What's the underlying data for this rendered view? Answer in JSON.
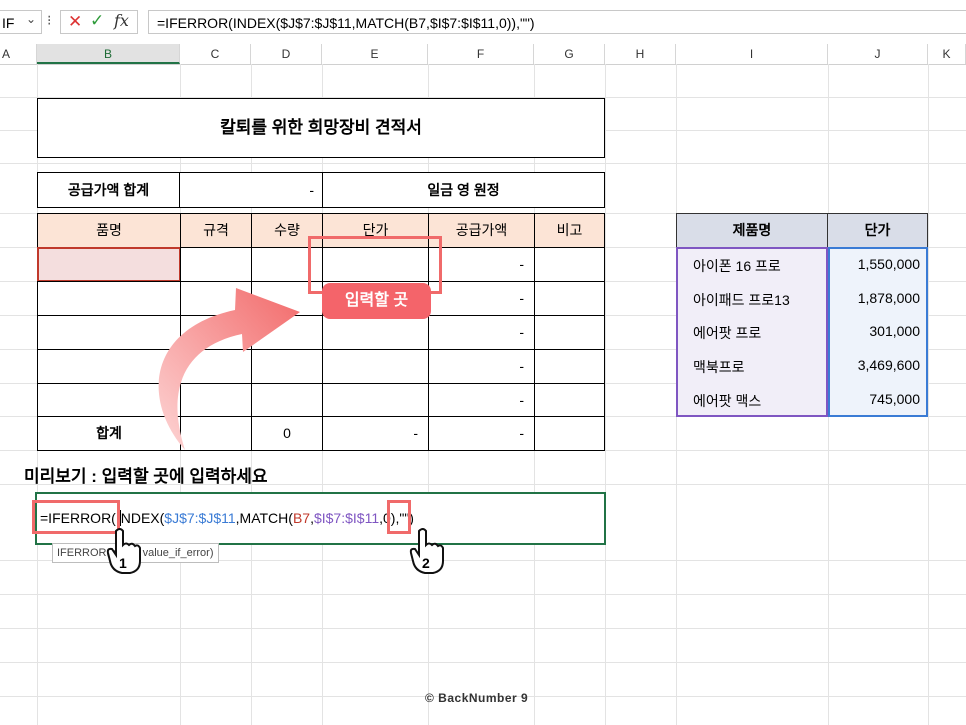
{
  "formula_bar": {
    "name_box": "IF",
    "chevron": "⌄",
    "dots": "⁝",
    "cancel_icon": "✕",
    "enter_icon": "✓",
    "fx_label": "fx",
    "formula": "=IFERROR(INDEX($J$7:$J$11,MATCH(B7,$I$7:$I$11,0)),\"\")"
  },
  "columns": [
    "A",
    "B",
    "C",
    "D",
    "E",
    "F",
    "G",
    "H",
    "I",
    "J",
    "K"
  ],
  "title": "칼퇴를 위한 희망장비 견적서",
  "summary": {
    "label": "공급가액 합계",
    "value": "-",
    "amount_text": "일금 영 원정"
  },
  "main_table": {
    "headers": [
      "품명",
      "규격",
      "수량",
      "단가",
      "공급가액",
      "비고"
    ],
    "rows": [
      {
        "supply": "-"
      },
      {
        "supply": "-"
      },
      {
        "supply": "-"
      },
      {
        "supply": "-"
      },
      {
        "supply": "-"
      }
    ],
    "total": {
      "label": "합계",
      "qty": "0",
      "price": "-",
      "supply": "-"
    }
  },
  "callout": "입력할 곳",
  "price_table": {
    "headers": [
      "제품명",
      "단가"
    ],
    "rows": [
      {
        "name": "아이폰 16 프로",
        "price": "1,550,000"
      },
      {
        "name": "아이패드 프로13",
        "price": "1,878,000"
      },
      {
        "name": "에어팟 프로",
        "price": "301,000"
      },
      {
        "name": "맥북프로",
        "price": "3,469,600"
      },
      {
        "name": "에어팟 맥스",
        "price": "745,000"
      }
    ]
  },
  "preview_label": "미리보기 : 입력할 곳에 입력하세요",
  "edit": {
    "p1": "=IFERROR(I",
    "p2": "NDEX(",
    "p3": "$J$7:$J$11",
    "p4": ",MATCH(",
    "p5": "B7",
    "p6": ",",
    "p7": "$I$7:$I$11",
    "p8": ",0",
    "p9": "),\"\")",
    "tooltip": "IFERROR(value, value_if_error)"
  },
  "hand_labels": [
    "1",
    "2"
  ],
  "credit": "© BackNumber 9",
  "colors": {
    "accent_green": "#217346",
    "header_fill": "#fce4d6",
    "callout": "#f4646a",
    "price_header": "#d9dde8",
    "price_row": "#eef0f7"
  }
}
